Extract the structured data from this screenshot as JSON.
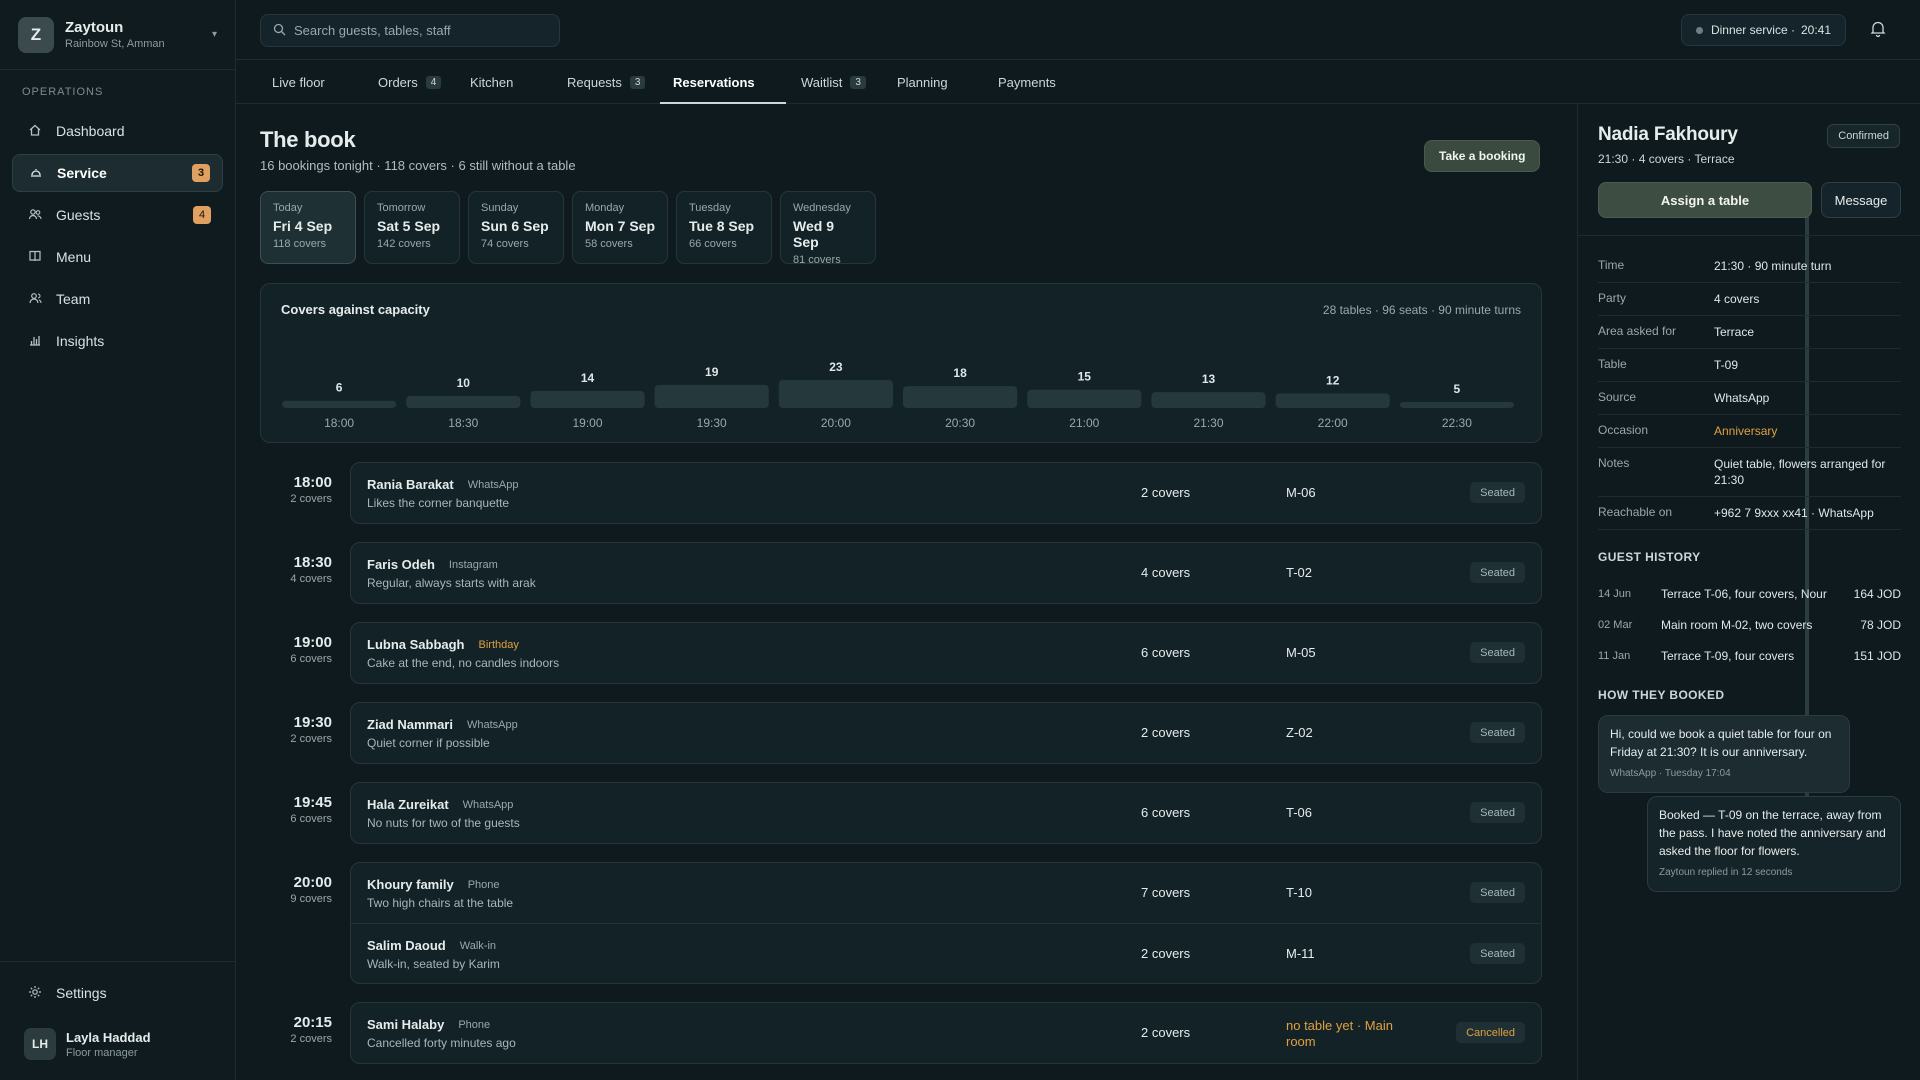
{
  "brand": {
    "initial": "Z",
    "name": "Zaytoun",
    "location": "Rainbow St, Amman"
  },
  "sidebar": {
    "section": "OPERATIONS",
    "items": [
      {
        "label": "Dashboard",
        "icon": "home-icon",
        "badge": null
      },
      {
        "label": "Service",
        "icon": "service-icon",
        "badge": "3",
        "active": true
      },
      {
        "label": "Guests",
        "icon": "guests-icon",
        "badge": "4"
      },
      {
        "label": "Menu",
        "icon": "menu-book-icon",
        "badge": null
      },
      {
        "label": "Team",
        "icon": "team-icon",
        "badge": null
      },
      {
        "label": "Insights",
        "icon": "insights-icon",
        "badge": null
      }
    ],
    "settings": "Settings",
    "user": {
      "initials": "LH",
      "name": "Layla Haddad",
      "role": "Floor manager"
    }
  },
  "topbar": {
    "search_placeholder": "Search guests, tables, staff",
    "service_label": "Dinner service ·",
    "service_time": "20:41"
  },
  "tabs": [
    {
      "label": "Live floor"
    },
    {
      "label": "Orders",
      "badge": "4"
    },
    {
      "label": "Kitchen"
    },
    {
      "label": "Requests",
      "badge": "3"
    },
    {
      "label": "Reservations",
      "active": true
    },
    {
      "label": "Waitlist",
      "badge": "3"
    },
    {
      "label": "Planning"
    },
    {
      "label": "Payments"
    }
  ],
  "page": {
    "title": "The book",
    "subtitle": "16 bookings tonight · 118 covers · 6 still without a table",
    "book_button": "Take a booking"
  },
  "days": [
    {
      "name": "Today",
      "date": "Fri 4 Sep",
      "covers": "118 covers",
      "active": true
    },
    {
      "name": "Tomorrow",
      "date": "Sat 5 Sep",
      "covers": "142 covers"
    },
    {
      "name": "Sunday",
      "date": "Sun 6 Sep",
      "covers": "74 covers"
    },
    {
      "name": "Monday",
      "date": "Mon 7 Sep",
      "covers": "58 covers"
    },
    {
      "name": "Tuesday",
      "date": "Tue 8 Sep",
      "covers": "66 covers"
    },
    {
      "name": "Wednesday",
      "date": "Wed 9 Sep",
      "covers": "81 covers"
    }
  ],
  "capacity": {
    "title": "Covers against capacity",
    "meta": "28 tables · 96 seats · 90 minute turns"
  },
  "chart_data": {
    "type": "bar",
    "title": "Covers against capacity",
    "categories": [
      "18:00",
      "18:30",
      "19:00",
      "19:30",
      "20:00",
      "20:30",
      "21:00",
      "21:30",
      "22:00",
      "22:30"
    ],
    "values": [
      6,
      10,
      14,
      19,
      23,
      18,
      15,
      13,
      12,
      5
    ],
    "ylim": [
      0,
      23
    ]
  },
  "reservations": [
    {
      "time": "18:00",
      "covers": "2 covers",
      "rows": [
        {
          "name": "Rania Barakat",
          "source": "WhatsApp",
          "note": "Likes the corner banquette",
          "covers": "2 covers",
          "table": "M-06",
          "status": "Seated"
        }
      ]
    },
    {
      "time": "18:30",
      "covers": "4 covers",
      "rows": [
        {
          "name": "Faris Odeh",
          "source": "Instagram",
          "note": "Regular, always starts with arak",
          "covers": "4 covers",
          "table": "T-02",
          "status": "Seated"
        }
      ]
    },
    {
      "time": "19:00",
      "covers": "6 covers",
      "rows": [
        {
          "name": "Lubna Sabbagh",
          "source": "Birthday",
          "occasion": true,
          "note": "Cake at the end, no candles indoors",
          "covers": "6 covers",
          "table": "M-05",
          "status": "Seated"
        }
      ]
    },
    {
      "time": "19:30",
      "covers": "2 covers",
      "rows": [
        {
          "name": "Ziad Nammari",
          "source": "WhatsApp",
          "note": "Quiet corner if possible",
          "covers": "2 covers",
          "table": "Z-02",
          "status": "Seated"
        }
      ]
    },
    {
      "time": "19:45",
      "covers": "6 covers",
      "rows": [
        {
          "name": "Hala Zureikat",
          "source": "WhatsApp",
          "note": "No nuts for two of the guests",
          "covers": "6 covers",
          "table": "T-06",
          "status": "Seated"
        }
      ]
    },
    {
      "time": "20:00",
      "covers": "9 covers",
      "rows": [
        {
          "name": "Khoury family",
          "source": "Phone",
          "note": "Two high chairs at the table",
          "covers": "7 covers",
          "table": "T-10",
          "status": "Seated"
        },
        {
          "name": "Salim Daoud",
          "source": "Walk-in",
          "note": "Walk-in, seated by Karim",
          "covers": "2 covers",
          "table": "M-11",
          "status": "Seated"
        }
      ]
    },
    {
      "time": "20:15",
      "covers": "2 covers",
      "rows": [
        {
          "name": "Sami Halaby",
          "source": "Phone",
          "note": "Cancelled forty minutes ago",
          "covers": "2 covers",
          "table": "no table yet · Main room",
          "warn": true,
          "status": "Cancelled",
          "cancel": true
        }
      ]
    }
  ],
  "detail": {
    "name": "Nadia Fakhoury",
    "status": "Confirmed",
    "summary": "21:30 · 4 covers · Terrace",
    "assign_button": "Assign a table",
    "message_button": "Message",
    "fields": [
      {
        "k": "Time",
        "v": "21:30 · 90 minute turn"
      },
      {
        "k": "Party",
        "v": "4 covers"
      },
      {
        "k": "Area asked for",
        "v": "Terrace"
      },
      {
        "k": "Table",
        "v": "T-09"
      },
      {
        "k": "Source",
        "v": "WhatsApp"
      },
      {
        "k": "Occasion",
        "v": "Anniversary",
        "accent": true
      },
      {
        "k": "Notes",
        "v": "Quiet table, flowers arranged for 21:30"
      },
      {
        "k": "Reachable on",
        "v": "+962 7 9xxx xx41 · WhatsApp"
      }
    ],
    "history_title": "GUEST HISTORY",
    "history": [
      {
        "date": "14 Jun",
        "text": "Terrace T-06, four covers, Nour",
        "amount": "164 JOD"
      },
      {
        "date": "02 Mar",
        "text": "Main room M-02, two covers",
        "amount": "78 JOD"
      },
      {
        "date": "11 Jan",
        "text": "Terrace T-09, four covers",
        "amount": "151 JOD"
      }
    ],
    "booked_title": "HOW THEY BOOKED",
    "messages": [
      {
        "text": "Hi, could we book a quiet table for four on Friday at 21:30? It is our anniversary.",
        "meta": "WhatsApp · Tuesday 17:04"
      },
      {
        "text": "Booked — T-09 on the terrace, away from the pass. I have noted the anniversary and asked the floor for flowers.",
        "meta": "Zaytoun replied in 12 seconds"
      }
    ]
  },
  "colors": {
    "accent": "#e0a040",
    "badge": "#e0a060",
    "primary_button": "#3e4d41",
    "background": "#0e1a1e"
  }
}
